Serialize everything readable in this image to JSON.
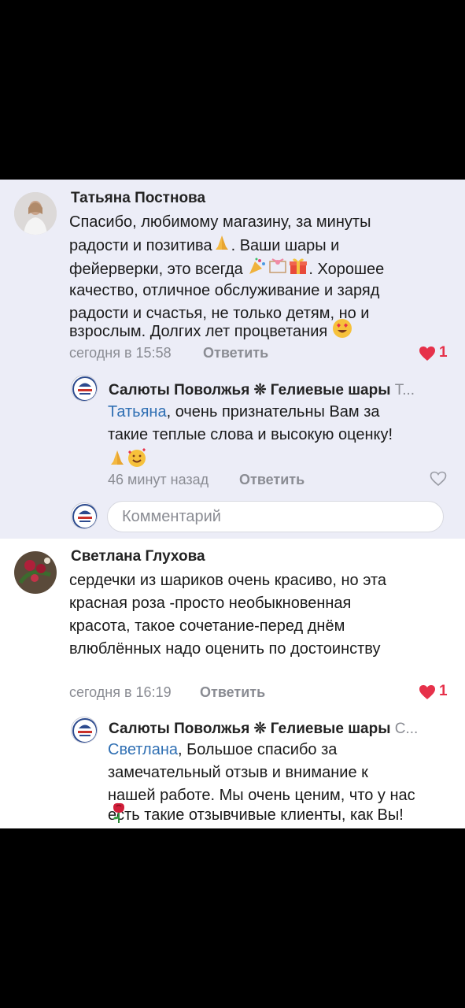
{
  "comments": [
    {
      "author": "Татьяна Постнова",
      "text_lines": [
        "Спасибо, любимому магазину, за минуты",
        "радости и позитива",
        ". Ваши шары и",
        "фейерверки, это всегда",
        ". Хорошее",
        "качество, отличное обслуживание и заряд",
        "радости и счастья, не только детям, но и",
        "взрослым. Долгих лет процветания"
      ],
      "time": "сегодня в 15:58",
      "reply_label": "Ответить",
      "likes": "1",
      "replies": [
        {
          "author": "Салюты Поволжья ❊ Гелиевые шары",
          "author_suffix": "Т...",
          "mention": "Татьяна",
          "text_lines": [
            ", очень признательны Вам за",
            "такие теплые слова и высокую оценку!"
          ],
          "time": "46 минут назад",
          "reply_label": "Ответить"
        }
      ]
    },
    {
      "author": "Светлана Глухова",
      "text_lines": [
        "сердечки из шариков очень красиво, но эта",
        "красная роза -просто необыкновенная",
        "красота, такое сочетание-перед днём",
        "влюблённых надо оценить по достоинству"
      ],
      "time": "сегодня в 16:19",
      "reply_label": "Ответить",
      "likes": "1",
      "replies": [
        {
          "author": "Салюты Поволжья ❊ Гелиевые шары",
          "author_suffix": "С...",
          "mention": "Светлана",
          "text_lines": [
            ", Большое спасибо за",
            "замечательный отзыв и внимание к",
            "нашей работе. Мы очень ценим, что у нас",
            "есть такие отзывчивые клиенты, как Вы!"
          ]
        }
      ]
    }
  ],
  "comment_input": {
    "placeholder": "Комментарий"
  },
  "colors": {
    "accent_link": "#2f6fb3",
    "like_red": "#e6314a",
    "panel_lavender": "#ecedf7"
  },
  "icons": [
    "heart-icon",
    "heart-outline-icon",
    "praying-hands-emoji",
    "party-popper-emoji",
    "gift-emoji",
    "heart-eyes-emoji",
    "smiling-hearts-emoji",
    "rose-emoji"
  ]
}
